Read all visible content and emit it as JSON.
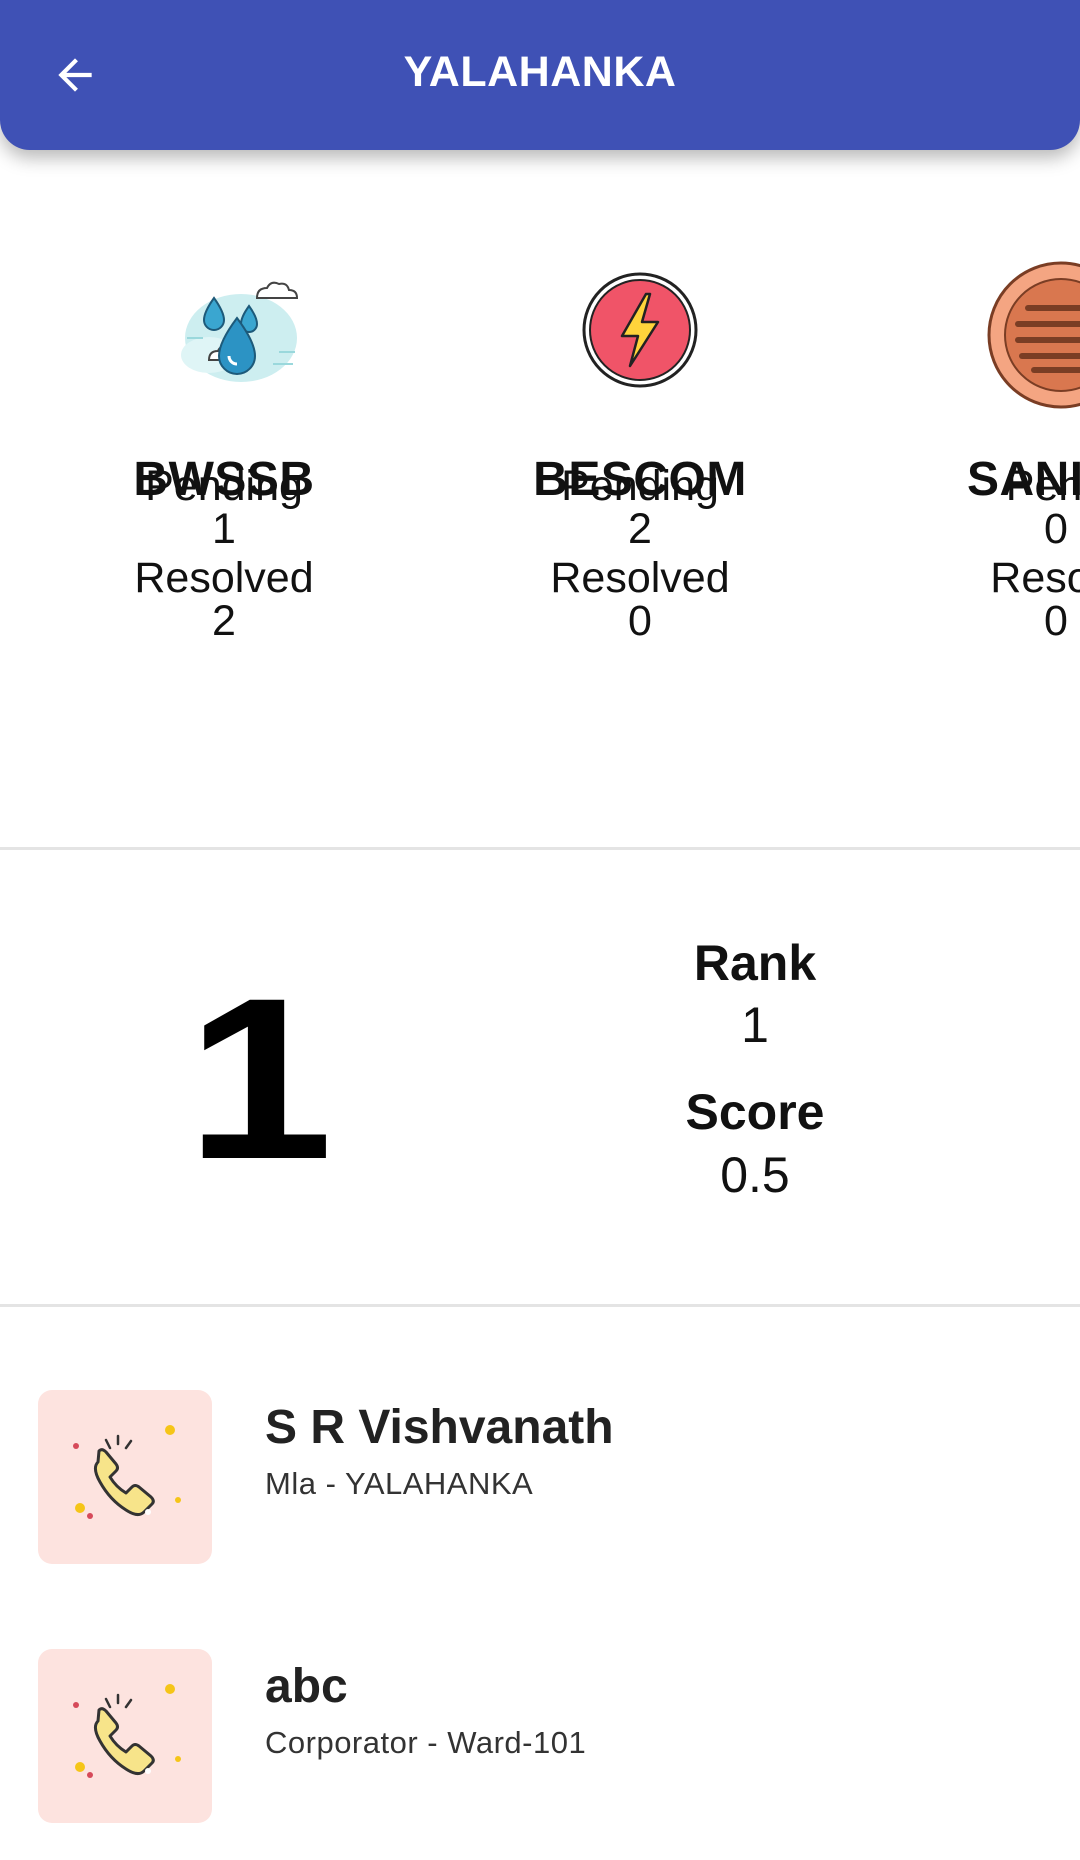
{
  "header": {
    "title": "YALAHANKA",
    "back_icon": "arrow-left-icon",
    "background_color": "#3f51b5"
  },
  "departments": [
    {
      "name": "BWSSB",
      "icon": "water-drops-icon",
      "pending_label": "Pending",
      "pending": "1",
      "resolved_label": "Resolved",
      "resolved": "2"
    },
    {
      "name": "BESCOM",
      "icon": "lightning-bolt-icon",
      "pending_label": "Pending",
      "pending": "2",
      "resolved_label": "Resolved",
      "resolved": "0"
    },
    {
      "name": "SANITA",
      "icon": "manhole-cover-icon",
      "pending_label": "Pend",
      "pending": "0",
      "resolved_label": "Resolv",
      "resolved": "0"
    }
  ],
  "ranking": {
    "big_rank": "1",
    "rank_label": "Rank",
    "rank_value": "1",
    "score_label": "Score",
    "score_value": "0.5"
  },
  "contacts": [
    {
      "name": "S R Vishvanath",
      "role": "Mla - YALAHANKA",
      "icon": "phone-call-icon"
    },
    {
      "name": "abc",
      "role": "Corporator - Ward-101",
      "icon": "phone-call-icon"
    }
  ]
}
